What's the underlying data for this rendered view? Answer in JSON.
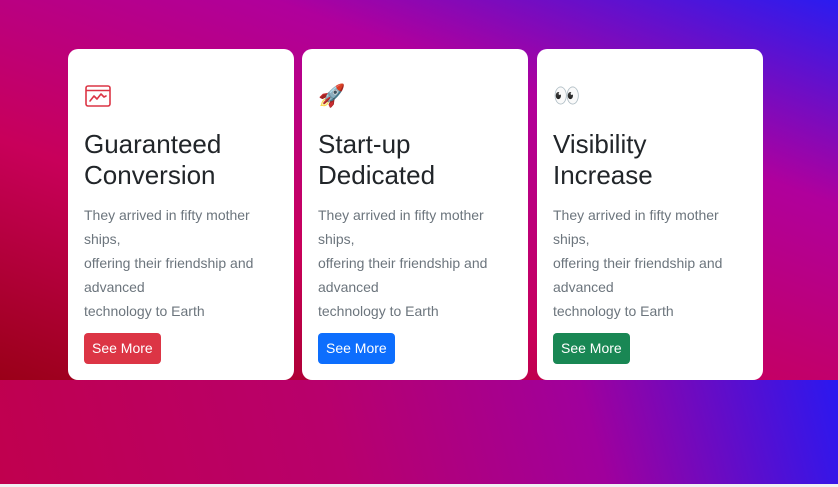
{
  "colors": {
    "danger": "#dc3545",
    "primary": "#0d6efd",
    "success": "#198754"
  },
  "cards": [
    {
      "icon": "chart-window-icon",
      "title_line1": "Guaranteed",
      "title_line2": "Conversion",
      "text_lines": [
        "They arrived in fifty mother",
        "ships,",
        "offering their friendship and",
        "advanced",
        "technology to Earth"
      ],
      "button_label": "See More",
      "button_color": "#dc3545"
    },
    {
      "icon": "rocket-icon",
      "emoji": "🚀",
      "title_line1": "Start-up",
      "title_line2": "Dedicated",
      "text_lines": [
        "They arrived in fifty mother",
        "ships,",
        "offering their friendship and",
        "advanced",
        "technology to Earth"
      ],
      "button_label": "See More",
      "button_color": "#0d6efd"
    },
    {
      "icon": "eyes-icon",
      "emoji": "👀",
      "title_line1": "Visibility",
      "title_line2": "Increase",
      "text_lines": [
        "They arrived in fifty mother",
        "ships,",
        "offering their friendship and",
        "advanced",
        "technology to Earth"
      ],
      "button_label": "See More",
      "button_color": "#198754"
    }
  ]
}
